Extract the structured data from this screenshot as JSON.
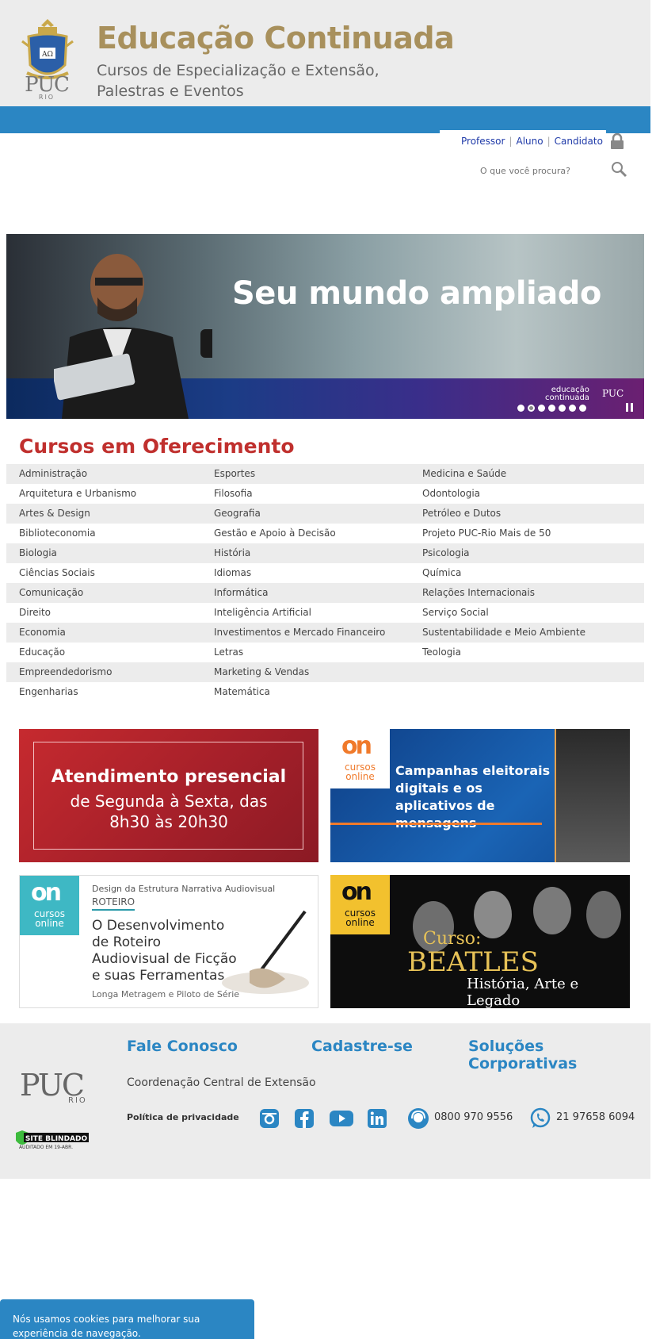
{
  "header": {
    "logo_text": "PUC",
    "logo_sub": "RIO",
    "title": "Educação Continuada",
    "subtitle": "Cursos de Especialização e Extensão, Palestras e Eventos"
  },
  "user_links": {
    "professor": "Professor",
    "aluno": "Aluno",
    "candidato": "Candidato",
    "separator": "|"
  },
  "search": {
    "placeholder": "O que você procura?"
  },
  "hero": {
    "title": "Seu mundo ampliado",
    "brand_line1": "educação",
    "brand_line2": "continuada",
    "brand_puc": "PUC",
    "slides_count": 7,
    "active_slide": 2
  },
  "courses": {
    "title": "Cursos em Oferecimento",
    "rows": [
      [
        "Administração",
        "Esportes",
        "Medicina e Saúde"
      ],
      [
        "Arquitetura e Urbanismo",
        "Filosofia",
        "Odontologia"
      ],
      [
        "Artes & Design",
        "Geografia",
        "Petróleo e Dutos"
      ],
      [
        "Biblioteconomia",
        "Gestão e Apoio à Decisão",
        "Projeto PUC-Rio Mais de 50"
      ],
      [
        "Biologia",
        "História",
        "Psicologia"
      ],
      [
        "Ciências Sociais",
        "Idiomas",
        "Química"
      ],
      [
        "Comunicação",
        "Informática",
        "Relações Internacionais"
      ],
      [
        "Direito",
        "Inteligência Artificial",
        "Serviço Social"
      ],
      [
        "Economia",
        "Investimentos e Mercado Financeiro",
        "Sustentabilidade e Meio Ambiente"
      ],
      [
        "Educação",
        "Letras",
        "Teologia"
      ],
      [
        "Empreendedorismo",
        "Marketing & Vendas",
        ""
      ],
      [
        "Engenharias",
        "Matemática",
        ""
      ]
    ]
  },
  "banners": {
    "atendimento": {
      "title": "Atendimento presencial",
      "line1": "de Segunda à Sexta, das",
      "line2": "8h30 às 20h30"
    },
    "campanhas": {
      "badge_on": "on",
      "badge_text": "cursos online",
      "text": "Campanhas eleitorais digitais e os aplicativos de mensagens"
    },
    "roteiro": {
      "badge_on": "on",
      "badge_text": "cursos online",
      "small": "Design da Estrutura Narrativa Audiovisual",
      "tag": "ROTEIRO",
      "title": "O Desenvolvimento de Roteiro Audiovisual de Ficção e suas Ferramentas",
      "foot": "Longa Metragem e Piloto de Série"
    },
    "beatles": {
      "badge_on": "on",
      "badge_text": "cursos online",
      "curso": "Curso:",
      "name": "BEATLES",
      "sub": "História, Arte e Legado"
    }
  },
  "footer": {
    "logo_text": "PUC",
    "logo_sub": "RIO",
    "fale_conosco": "Fale Conosco",
    "cadastre": "Cadastre-se",
    "solucoes": "Soluções Corporativas",
    "coordenacao": "Coordenação Central de Extensão",
    "privacidade": "Política de privacidade",
    "phone1": "0800 970 9556",
    "phone2": "21 97658 6094",
    "shield_title": "SITE BLINDADO",
    "shield_sub": "AUDITADO EM 19-ABR."
  },
  "cookie": {
    "text": "Nós usamos cookies para melhorar sua experiência de navegação."
  },
  "colors": {
    "gold": "#a8905c",
    "blue": "#2b86c3",
    "red": "#c0302e",
    "header_bg": "#ececec"
  }
}
